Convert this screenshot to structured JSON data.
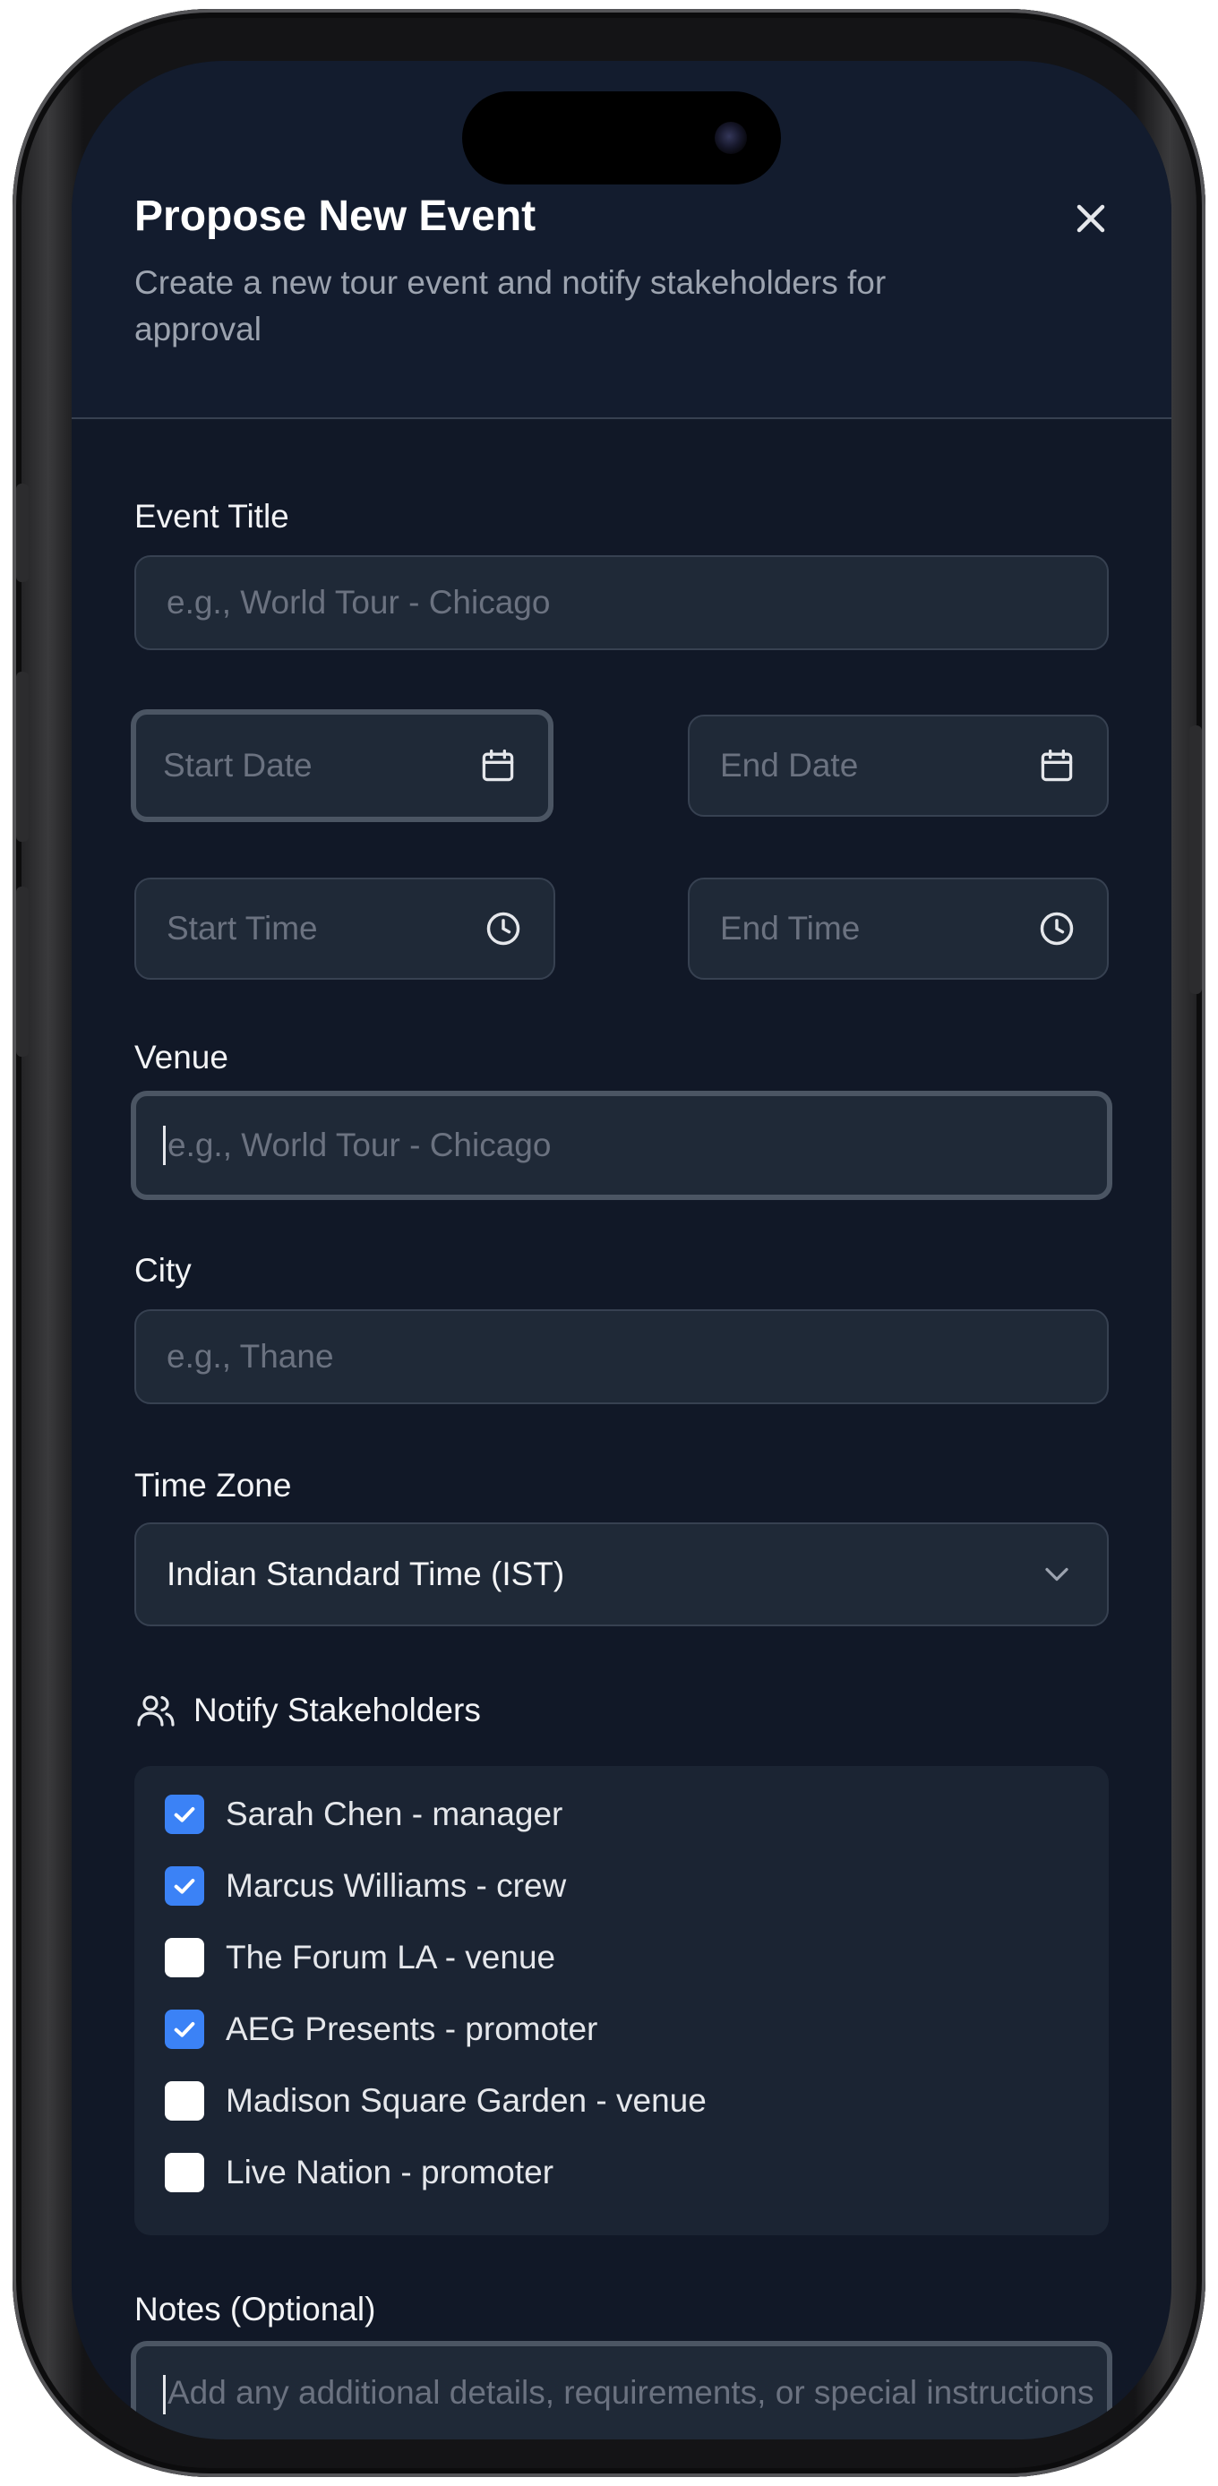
{
  "modal": {
    "title": "Propose New Event",
    "subtitle": "Create a new tour event and notify stakeholders for approval"
  },
  "form": {
    "event_title": {
      "label": "Event Title",
      "placeholder": "e.g., World Tour - Chicago",
      "value": ""
    },
    "start_date": {
      "placeholder": "Start Date",
      "icon": "calendar-icon"
    },
    "end_date": {
      "placeholder": "End Date",
      "icon": "calendar-icon"
    },
    "start_time": {
      "placeholder": "Start Time",
      "icon": "clock-icon"
    },
    "end_time": {
      "placeholder": "End Time",
      "icon": "clock-icon"
    },
    "venue": {
      "label": "Venue",
      "placeholder": "e.g., World Tour - Chicago",
      "value": ""
    },
    "city": {
      "label": "City",
      "placeholder": "e.g., Thane",
      "value": ""
    },
    "time_zone": {
      "label": "Time Zone",
      "selected": "Indian Standard Time (IST)"
    },
    "notes": {
      "label": "Notes (Optional)",
      "placeholder": "Add any additional details, requirements, or special instructions"
    }
  },
  "stakeholders": {
    "label": "Notify Stakeholders",
    "items": [
      {
        "label": "Sarah Chen - manager",
        "checked": true
      },
      {
        "label": "Marcus Williams - crew",
        "checked": true
      },
      {
        "label": "The Forum LA - venue",
        "checked": false
      },
      {
        "label": "AEG Presents - promoter",
        "checked": true
      },
      {
        "label": "Madison Square Garden - venue",
        "checked": false
      },
      {
        "label": "Live Nation - promoter",
        "checked": false
      }
    ]
  },
  "colors": {
    "background": "#111827",
    "field": "#1f2937",
    "accent": "#3b82f6"
  }
}
